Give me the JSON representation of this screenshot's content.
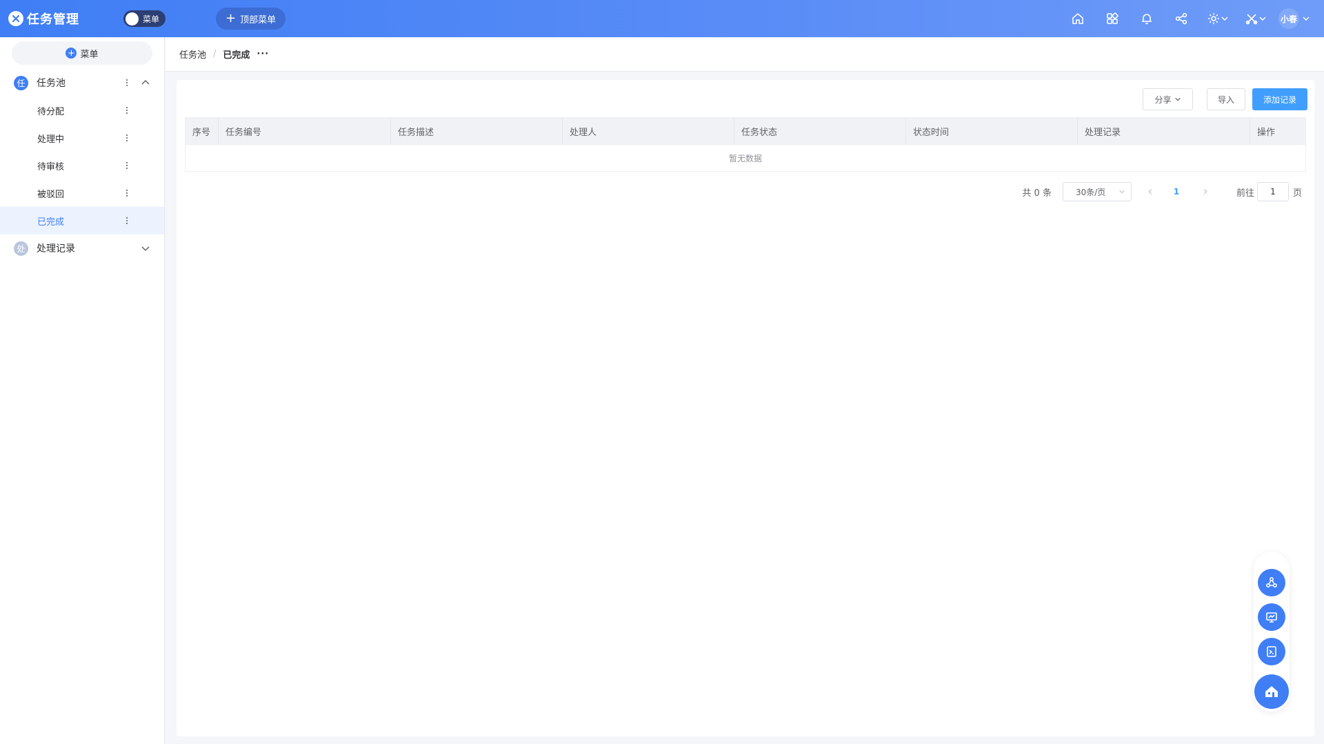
{
  "app": {
    "title": "任务管理",
    "toggle_label": "菜单",
    "top_menu_label": "顶部菜单"
  },
  "header": {
    "icons": [
      "home-icon",
      "apps-grid-icon",
      "bell-icon",
      "share-icon",
      "gear-icon",
      "tools-icon"
    ],
    "user_name": "小春"
  },
  "sidebar": {
    "add_label": "菜单",
    "groups": [
      {
        "avatar": "任",
        "label": "任务池",
        "expanded": true,
        "items": [
          "待分配",
          "处理中",
          "待审核",
          "被驳回",
          "已完成"
        ],
        "active_item": "已完成"
      },
      {
        "avatar": "处",
        "label": "处理记录",
        "expanded": false
      }
    ]
  },
  "breadcrumb": {
    "parent": "任务池",
    "separator": "/",
    "current": "已完成",
    "more": "···"
  },
  "toolbar": {
    "share_label": "分享",
    "import_label": "导入",
    "add_label": "添加记录"
  },
  "table": {
    "columns": [
      "序号",
      "任务编号",
      "任务描述",
      "处理人",
      "任务状态",
      "状态时间",
      "处理记录",
      "操作"
    ],
    "empty_text": "暂无数据"
  },
  "pagination": {
    "total_text": "共 0 条",
    "page_size": "30条/页",
    "current_page": "1",
    "goto_label": "前往",
    "goto_value": "1",
    "page_suffix": "页"
  },
  "colors": {
    "accent": "#3f7ef5",
    "primary_button": "#409eff"
  }
}
